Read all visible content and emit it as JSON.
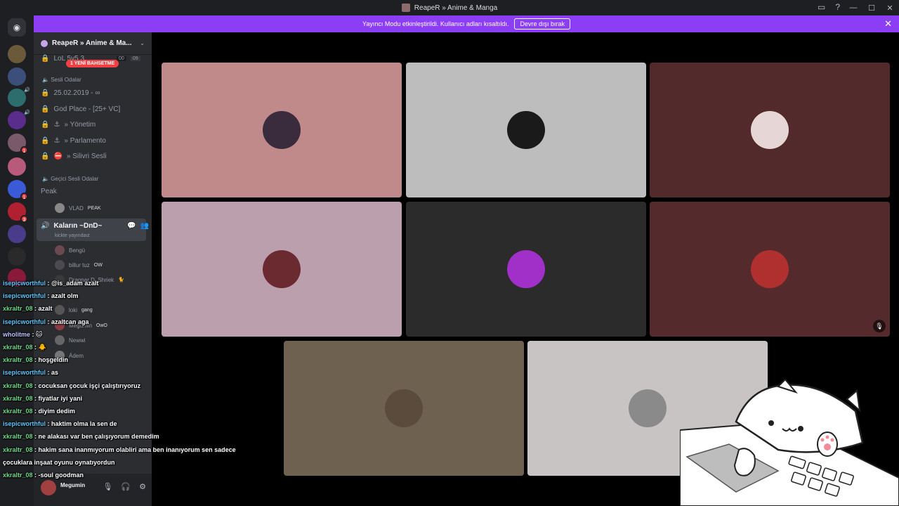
{
  "window": {
    "title": "ReapeR » Anime & Manga",
    "controls": [
      "—",
      "☐",
      "✕"
    ]
  },
  "banner": {
    "message": "Yayıncı Modu etkinleştirildi. Kullanıcı adları kısaltıldı.",
    "button_label": "Devre dışı bırak"
  },
  "servers": {
    "badges": [
      "1",
      "1",
      "3"
    ]
  },
  "guild": {
    "name": "ReapeR » Anime & Ma...",
    "mention_pill": "1 YENİ BAHSETME",
    "top_channel": "LoL 5v5 3",
    "top_channel_counts": [
      "00",
      "09"
    ],
    "categories": [
      "Sesli Odalar",
      "Geçici Sesli Odalar"
    ],
    "voice_channels": [
      "25.02.2019 - ∞",
      "God Place - [25+ VC]",
      "» Yönetim",
      "» Parlamento",
      "» Silivri Sesli"
    ],
    "temp_channels": {
      "peak": {
        "name": "Peak",
        "users": [
          {
            "name": "VLAD",
            "tag": "PEAK"
          }
        ]
      },
      "active": {
        "name": "Kaların ~DnD~",
        "sub": "kickte yayındaız",
        "users": [
          {
            "name": "Bengü",
            "tag": ""
          },
          {
            "name": "billur tuz",
            "tag": "OW"
          },
          {
            "name": "Dragnar D. Shriek",
            "tag": "🐈"
          },
          {
            "name": "loki",
            "tag": "gang"
          },
          {
            "name": "Megumin",
            "tag": "OwO"
          },
          {
            "name": "Newwi",
            "tag": ""
          },
          {
            "name": "Ádem",
            "tag": ""
          }
        ]
      }
    }
  },
  "userbar": {
    "name": "Megumin"
  },
  "chat": [
    {
      "user": "isepicworthful",
      "msg": "@is_adam azalt",
      "cls": "u"
    },
    {
      "user": "isepicworthful",
      "msg": "azalt olm",
      "cls": "u"
    },
    {
      "user": "xkraltr_08",
      "msg": "azalt",
      "cls": "u2"
    },
    {
      "user": "isepicworthful",
      "msg": "azaltcan aga",
      "cls": "u"
    },
    {
      "user": "wholitme",
      "msg": "🐱",
      "cls": "u3"
    },
    {
      "user": "xkraltr_08",
      "msg": "🐥",
      "cls": "u2"
    },
    {
      "user": "xkraltr_08",
      "msg": "hoşgeldin",
      "cls": "u2"
    },
    {
      "user": "isepicworthful",
      "msg": "as",
      "cls": "u"
    },
    {
      "user": "xkraltr_08",
      "msg": "cocuksan çocuk işçi çalıştırıyoruz",
      "cls": "u2"
    },
    {
      "user": "xkraltr_08",
      "msg": "fiyatlar iyi yani",
      "cls": "u2"
    },
    {
      "user": "xkraltr_08",
      "msg": "diyim dedim",
      "cls": "u2"
    },
    {
      "user": "isepicworthful",
      "msg": "haktim olma la sen de",
      "cls": "u"
    },
    {
      "user": "xkraltr_08",
      "msg": "ne alakası var ben çalışıyorum demedim",
      "cls": "u2"
    },
    {
      "user": "xkraltr_08",
      "msg": "hakim sana inanmıyorum olabliri ama ben inanıyorum sen sadece",
      "cls": "u2"
    },
    {
      "user": "",
      "msg": "çocuklara inşaat oyunu oynatıyordun",
      "cls": "u2"
    },
    {
      "user": "xkraltr_08",
      "msg": "-soul goodman",
      "cls": "u2"
    }
  ],
  "tiles": [
    {
      "name": "tile-1",
      "bg": "#c08a8a",
      "av": "#3a2c3c"
    },
    {
      "name": "tile-2",
      "bg": "#bdbdbd",
      "av": "#1a1a1a"
    },
    {
      "name": "tile-3",
      "bg": "#522a2c",
      "av": "#e6d6d6"
    },
    {
      "name": "tile-4",
      "bg": "#bc9fac",
      "av": "#6a2a30"
    },
    {
      "name": "tile-5",
      "bg": "#2b2b2b",
      "av": "#a030c8"
    },
    {
      "name": "tile-6",
      "bg": "#552a2c",
      "av": "#b03030",
      "muted": true
    },
    {
      "name": "tile-7",
      "bg": "#6e6150",
      "av": "#5a4b3c"
    },
    {
      "name": "tile-8",
      "bg": "#c8c4c4",
      "av": "#8a8a8a"
    }
  ],
  "colors": {
    "accent": "#8c3ef5",
    "mention": "#f23f43"
  }
}
